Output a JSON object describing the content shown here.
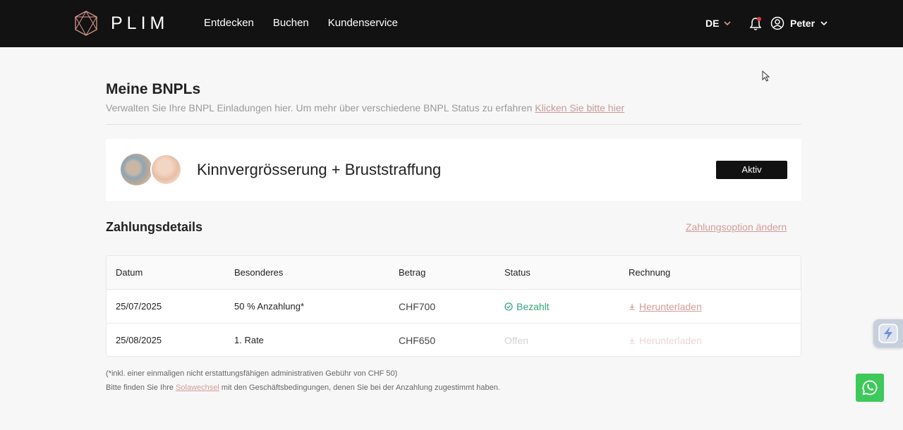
{
  "brand": {
    "name": "PLIM"
  },
  "nav": {
    "items": [
      "Entdecken",
      "Buchen",
      "Kundenservice"
    ]
  },
  "header": {
    "language": "DE",
    "user_name": "Peter"
  },
  "page": {
    "title": "Meine BNPLs",
    "subtitle": "Verwalten Sie Ihre BNPL Einladungen hier. Um mehr über verschiedene BNPL Status zu erfahren",
    "subtitle_link": "Klicken Sie bitte hier"
  },
  "plan": {
    "name": "Kinnvergrösserung + Bruststraffung",
    "status": "Aktiv"
  },
  "payments": {
    "title": "Zahlungsdetails",
    "change_link": "Zahlungsoption ändern",
    "columns": [
      "Datum",
      "Besonderes",
      "Betrag",
      "Status",
      "Rechnung"
    ],
    "rows": [
      {
        "date": "25/07/2025",
        "note": "50 % Anzahlung*",
        "amount": "CHF700",
        "status": "Bezahlt",
        "invoice": "Herunterladen"
      },
      {
        "date": "25/08/2025",
        "note": "1. Rate",
        "amount": "CHF650",
        "status": "Offen",
        "invoice": "Herunterladen"
      }
    ]
  },
  "footnotes": {
    "line1": "(*inkl. einer einmaligen nicht erstattungsfähigen administrativen Gebühr von CHF 50)",
    "line2_prefix": "Bitte finden Sie Ihre",
    "line2_link": "Solawechsel",
    "line2_suffix": "mit den Geschäftsbedingungen, denen Sie bei der Anzahlung zugestimmt haben."
  },
  "colors": {
    "header_bg": "#121212",
    "accent": "#d19c97",
    "paid": "#35a57a",
    "whatsapp": "#3ec95b"
  },
  "icons": [
    "logo-mark-icon",
    "chevron-down-icon",
    "bell-icon",
    "user-circle-icon",
    "check-circle-icon",
    "download-icon",
    "whatsapp-icon",
    "widget-icon"
  ]
}
